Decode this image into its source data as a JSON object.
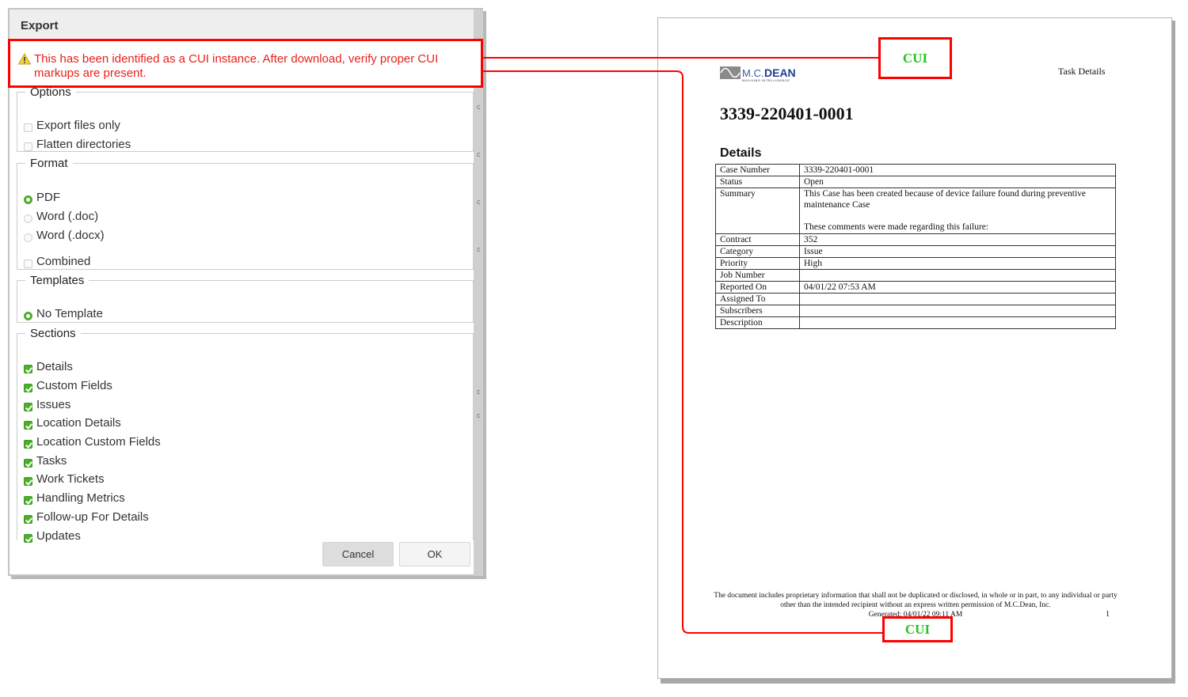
{
  "dialog": {
    "title": "Export",
    "warning": {
      "icon": "warning-triangle-icon",
      "text": "This has been identified as a CUI instance. After download, verify proper CUI markups are present."
    },
    "options": {
      "legend": "Options",
      "items": [
        {
          "label": "Export files only",
          "checked": false
        },
        {
          "label": "Flatten directories",
          "checked": false
        }
      ]
    },
    "format": {
      "legend": "Format",
      "radios": [
        {
          "label": "PDF",
          "selected": true
        },
        {
          "label": "Word (.doc)",
          "selected": false
        },
        {
          "label": "Word (.docx)",
          "selected": false
        }
      ],
      "combined": {
        "label": "Combined",
        "checked": false
      }
    },
    "templates": {
      "legend": "Templates",
      "radios": [
        {
          "label": "No Template",
          "selected": true
        }
      ]
    },
    "sections": {
      "legend": "Sections",
      "items": [
        {
          "label": "Details",
          "checked": true
        },
        {
          "label": "Custom Fields",
          "checked": true
        },
        {
          "label": "Issues",
          "checked": true
        },
        {
          "label": "Location Details",
          "checked": true
        },
        {
          "label": "Location Custom Fields",
          "checked": true
        },
        {
          "label": "Tasks",
          "checked": true
        },
        {
          "label": "Work Tickets",
          "checked": true
        },
        {
          "label": "Handling Metrics",
          "checked": true
        },
        {
          "label": "Follow-up For Details",
          "checked": true
        },
        {
          "label": "Updates",
          "checked": true
        }
      ]
    },
    "buttons": {
      "cancel": "Cancel",
      "ok": "OK"
    }
  },
  "pdf_page": {
    "logo": {
      "brand_light": "M.C.",
      "brand_bold": "DEAN",
      "tagline": "BUILDING INTELLIGENCE"
    },
    "header_right": "Task Details",
    "case_title": "3339-220401-0001",
    "section_heading": "Details",
    "details_rows": [
      {
        "key": "Case Number",
        "value": "3339-220401-0001"
      },
      {
        "key": "Status",
        "value": "Open"
      },
      {
        "key": "Summary",
        "value": "This Case has been created because of device failure found during preventive maintenance Case",
        "value2": "These comments were made regarding this failure:"
      },
      {
        "key": "Contract",
        "value": "352"
      },
      {
        "key": "Category",
        "value": "Issue"
      },
      {
        "key": "Priority",
        "value": "High"
      },
      {
        "key": "Job Number",
        "value": ""
      },
      {
        "key": "Reported On",
        "value": "04/01/22 07:53 AM"
      },
      {
        "key": "Assigned To",
        "value": ""
      },
      {
        "key": "Subscribers",
        "value": ""
      },
      {
        "key": "Description",
        "value": ""
      }
    ],
    "footer": {
      "disclaimer": "The document includes proprietary information that shall not be duplicated or disclosed, in whole or in part, to any individual or party other than the intended recipient without an express written permission of M.C.Dean, Inc.",
      "generated": "Generated: 04/01/22 09:11 AM",
      "page_number": "1"
    }
  },
  "annotations": {
    "cui_top": "CUI",
    "cui_bottom": "CUI",
    "highlight_color": "#ff0000",
    "cui_text_color": "#22c422"
  }
}
